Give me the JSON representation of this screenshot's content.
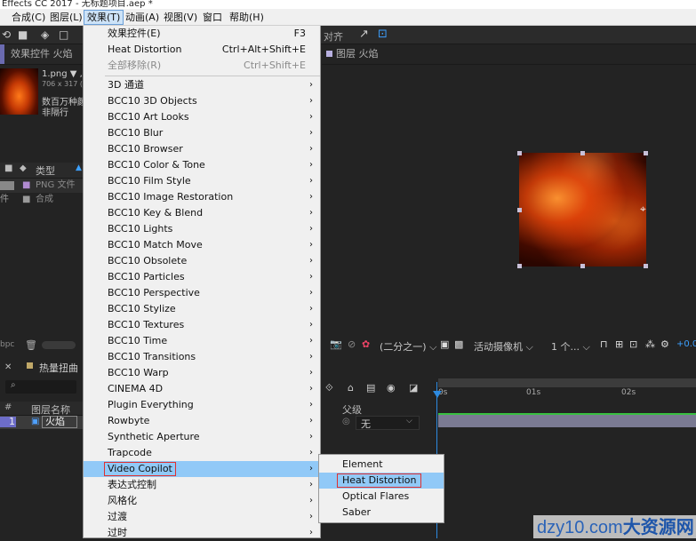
{
  "window": {
    "title": "Effects CC 2017 - 无标题项目.aep *"
  },
  "menubar": {
    "items": [
      {
        "label": "合成(C)"
      },
      {
        "label": "图层(L)"
      },
      {
        "label": "效果(T)"
      },
      {
        "label": "动画(A)"
      },
      {
        "label": "视图(V)"
      },
      {
        "label": "窗口"
      },
      {
        "label": "帮助(H)"
      }
    ]
  },
  "toolbar": {
    "align_label": "对齐"
  },
  "left_panel": {
    "tab_label": "效果控件 火焰",
    "file_name": "1.png ▼ ,",
    "file_info": "706 x 317 (1",
    "desc_line1": "数百万种颜",
    "desc_line2": "非隔行",
    "col_type": "类型",
    "rows": [
      {
        "type": "PNG 文件"
      },
      {
        "name": "件",
        "type": "合成"
      }
    ],
    "bpc": "bpc"
  },
  "comp_panel": {
    "tab_label": "图层 火焰",
    "zoom": "(二分之一)",
    "camera": "活动摄像机",
    "views": "1 个...",
    "offset": "+0.0"
  },
  "timeline": {
    "tab_label": "热量扭曲",
    "col_layer_name": "图层名称",
    "col_parent": "父级",
    "layer_index": "1",
    "layer_name": "火焰",
    "parent_value": "无",
    "ruler": [
      "0s",
      "01s",
      "02s"
    ]
  },
  "effects_menu": {
    "items": [
      {
        "label": "效果控件(E)",
        "shortcut": "F3"
      },
      {
        "label": "Heat Distortion",
        "shortcut": "Ctrl+Alt+Shift+E"
      },
      {
        "label": "全部移除(R)",
        "shortcut": "Ctrl+Shift+E",
        "disabled": true
      },
      {
        "label": "3D 通道",
        "submenu": true
      },
      {
        "label": "BCC10 3D Objects",
        "submenu": true
      },
      {
        "label": "BCC10 Art Looks",
        "submenu": true
      },
      {
        "label": "BCC10 Blur",
        "submenu": true
      },
      {
        "label": "BCC10 Browser",
        "submenu": true
      },
      {
        "label": "BCC10 Color & Tone",
        "submenu": true
      },
      {
        "label": "BCC10 Film Style",
        "submenu": true
      },
      {
        "label": "BCC10 Image Restoration",
        "submenu": true
      },
      {
        "label": "BCC10 Key & Blend",
        "submenu": true
      },
      {
        "label": "BCC10 Lights",
        "submenu": true
      },
      {
        "label": "BCC10 Match Move",
        "submenu": true
      },
      {
        "label": "BCC10 Obsolete",
        "submenu": true
      },
      {
        "label": "BCC10 Particles",
        "submenu": true
      },
      {
        "label": "BCC10 Perspective",
        "submenu": true
      },
      {
        "label": "BCC10 Stylize",
        "submenu": true
      },
      {
        "label": "BCC10 Textures",
        "submenu": true
      },
      {
        "label": "BCC10 Time",
        "submenu": true
      },
      {
        "label": "BCC10 Transitions",
        "submenu": true
      },
      {
        "label": "BCC10 Warp",
        "submenu": true
      },
      {
        "label": "CINEMA 4D",
        "submenu": true
      },
      {
        "label": "Plugin Everything",
        "submenu": true
      },
      {
        "label": "Rowbyte",
        "submenu": true
      },
      {
        "label": "Synthetic Aperture",
        "submenu": true
      },
      {
        "label": "Trapcode",
        "submenu": true
      },
      {
        "label": "Video Copilot",
        "submenu": true,
        "highlighted": true
      },
      {
        "label": "表达式控制",
        "submenu": true
      },
      {
        "label": "风格化",
        "submenu": true
      },
      {
        "label": "过渡",
        "submenu": true
      },
      {
        "label": "过时",
        "submenu": true
      }
    ]
  },
  "video_copilot_submenu": {
    "items": [
      {
        "label": "Element"
      },
      {
        "label": "Heat Distortion",
        "highlighted": true
      },
      {
        "label": "Optical Flares"
      },
      {
        "label": "Saber"
      }
    ]
  },
  "watermark": {
    "latin": "dzy10.com",
    "cn": "大资源网"
  },
  "colors": {
    "menu_highlight": "#91c9f7",
    "callout_red": "#e03030",
    "panel_bg": "#232323"
  }
}
